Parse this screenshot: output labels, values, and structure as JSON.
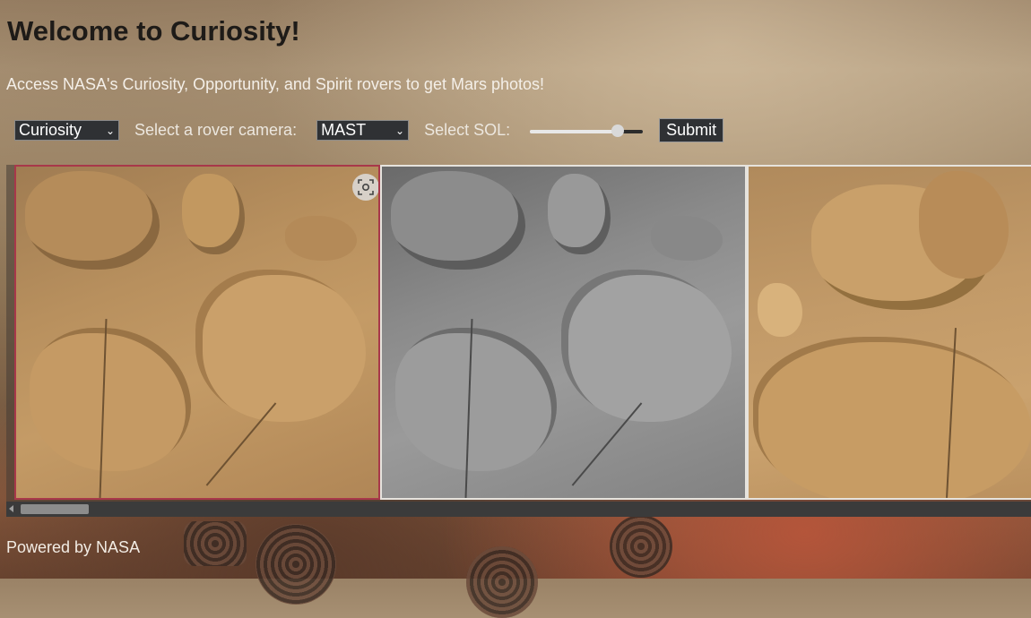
{
  "page": {
    "title": "Welcome to Curiosity!",
    "subtitle": "Access NASA's Curiosity, Opportunity, and Spirit rovers to get Mars photos!"
  },
  "controls": {
    "rover_select": {
      "value": "Curiosity"
    },
    "camera_label": "Select a rover camera:",
    "camera_select": {
      "value": "MAST"
    },
    "sol_label": "Select SOL:",
    "sol_slider": {
      "position_fraction": 0.78
    },
    "submit_label": "Submit"
  },
  "gallery": {
    "photos": [
      {
        "tone": "color",
        "selected": true,
        "has_lens_button": true
      },
      {
        "tone": "grayscale",
        "selected": false,
        "has_lens_button": false
      },
      {
        "tone": "color",
        "selected": false,
        "has_lens_button": false
      }
    ],
    "scroll_position_fraction": 0.0
  },
  "footer": {
    "text": "Powered by NASA"
  },
  "icons": {
    "lens": "visual-search-icon",
    "dropdown": "chevron-down-icon",
    "scroll_left": "scroll-left-arrow-icon"
  },
  "colors": {
    "selected_border": "#a8384a",
    "control_bg": "#2f3134"
  }
}
